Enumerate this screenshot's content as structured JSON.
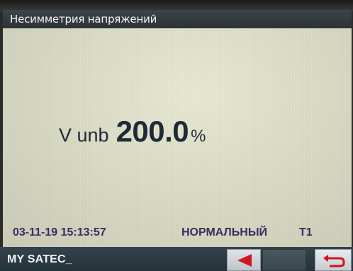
{
  "screen": {
    "title": "Несимметрия напряжений"
  },
  "reading": {
    "label": "V unb",
    "value": "200.0",
    "unit": "%"
  },
  "status": {
    "datetime": "03-11-19 15:13:57",
    "mode": "НОРМАЛЬНЫЙ",
    "tariff": "T1"
  },
  "footer": {
    "device_name": "MY SATEC_"
  },
  "icons": {
    "back": "left-arrow-icon",
    "return": "return-arrow-icon"
  },
  "colors": {
    "title_bar": "#2c3336",
    "screen_bg": "#d7d9c4",
    "value_text": "#1f2a38",
    "status_text": "#3a2c5e",
    "back_arrow": "#d0161f",
    "return_icon": "#d0161f"
  }
}
